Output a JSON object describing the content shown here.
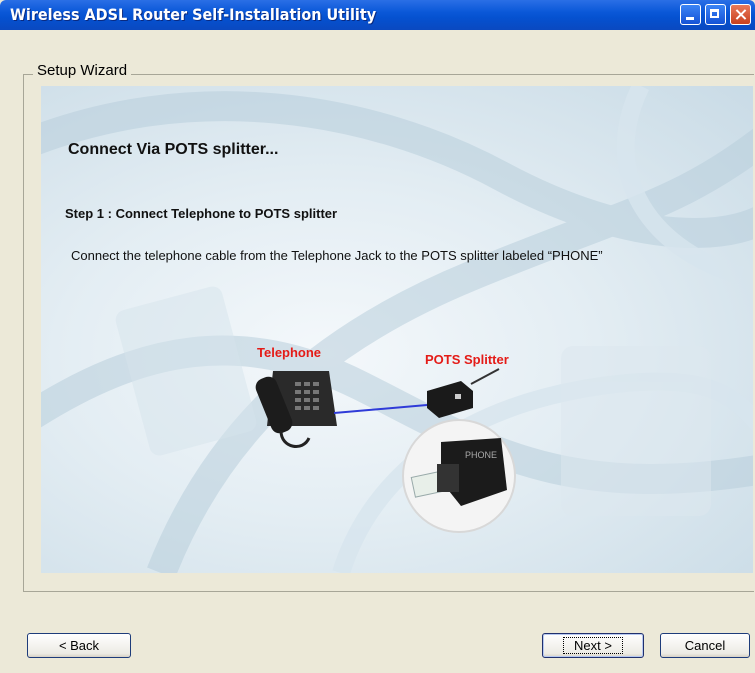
{
  "window": {
    "title": "Wireless ADSL Router Self-Installation Utility"
  },
  "group": {
    "label": "Setup Wizard"
  },
  "content": {
    "heading": "Connect Via POTS splitter...",
    "step": "Step 1 : Connect Telephone to POTS splitter",
    "description": "Connect the telephone cable from the Telephone Jack to the POTS splitter labeled “PHONE”",
    "telephone_label": "Telephone",
    "splitter_label": "POTS Splitter",
    "port_label": "PHONE"
  },
  "buttons": {
    "back": "< Back",
    "next": "Next >",
    "cancel": "Cancel"
  },
  "colors": {
    "titlebar": "#0a58d8",
    "label_red": "#e41b17",
    "cable": "#2f3bd8",
    "dialog": "#ece9d8"
  },
  "icons": {
    "minimize": "minimize-icon",
    "maximize": "maximize-icon",
    "close": "close-icon"
  }
}
